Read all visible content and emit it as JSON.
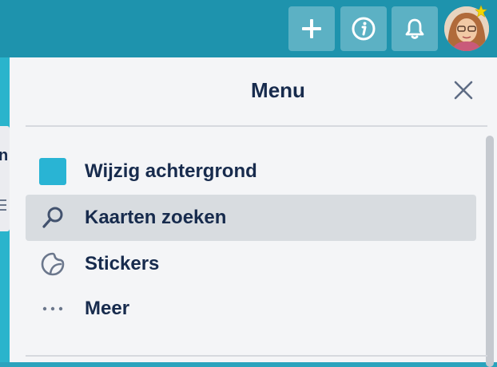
{
  "header": {
    "add_icon": "plus-icon",
    "info_icon": "info-icon",
    "notifications_icon": "bell-icon",
    "avatar_badge_icon": "star-icon"
  },
  "board": {
    "visible_fragment": "n"
  },
  "menu": {
    "title": "Menu",
    "close_icon": "close-icon",
    "items": [
      {
        "label": "Wijzig achtergrond",
        "icon": "background-color-swatch",
        "color": "#29b4d4",
        "active": false
      },
      {
        "label": "Kaarten zoeken",
        "icon": "search-icon",
        "active": true
      },
      {
        "label": "Stickers",
        "icon": "sticker-icon",
        "active": false
      },
      {
        "label": "Meer",
        "icon": "more-icon",
        "active": false
      }
    ]
  },
  "colors": {
    "header_bg": "#1e93ad",
    "panel_bg": "#f4f5f7",
    "text": "#172b4d",
    "active_item_bg": "#d8dce0",
    "accent": "#29b4d4"
  }
}
